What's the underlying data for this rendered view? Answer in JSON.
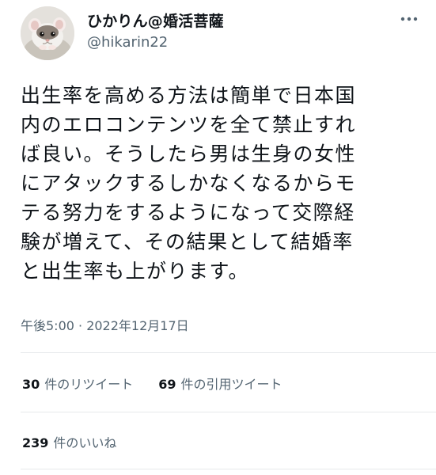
{
  "user": {
    "display_name": "ひかりん@婚活菩薩",
    "handle": "@hikarin22",
    "avatar_icon": "hamster-avatar"
  },
  "menu": {
    "icon": "more-horizontal-icon"
  },
  "tweet": {
    "lines": [
      "出生率を高める方法は簡単で日本国",
      "内のエロコンテンツを全て禁止すれ",
      "ば良い。そうしたら男は生身の女性",
      "にアタックするしかなくなるからモ",
      "テる努力をするようになって交際経",
      "験が増えて、その結果として結婚率",
      "と出生率も上がります。"
    ],
    "timestamp": "午後5:00 · 2022年12月17日"
  },
  "stats": {
    "retweets_count": "30",
    "retweets_label": "件のリツイート",
    "quotes_count": "69",
    "quotes_label": "件の引用ツイート",
    "likes_count": "239",
    "likes_label": "件のいいね"
  },
  "colors": {
    "text": "#0f1419",
    "secondary": "#536471",
    "divider": "#e6e9eb"
  }
}
